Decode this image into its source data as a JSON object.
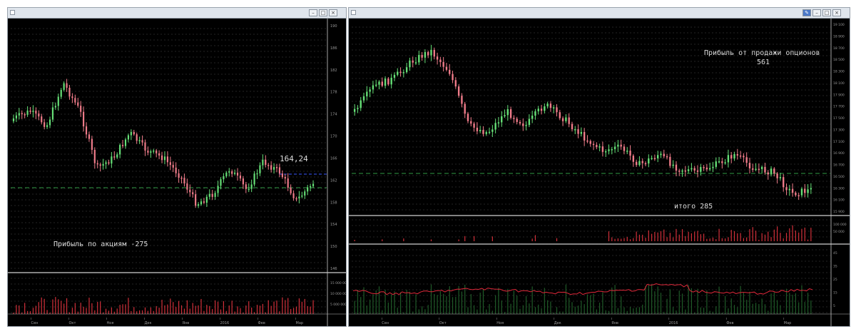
{
  "windows": [
    {
      "id": "left",
      "title": "",
      "annotation_price": "164,24",
      "annotation_profit": "Прибыль по акциям -275",
      "price_axis": [
        "190",
        "186",
        "182",
        "178",
        "174",
        "170",
        "166",
        "162",
        "158",
        "154",
        "150",
        "146"
      ],
      "volume_axis": [
        "15 000 000",
        "10 000 000",
        "5 000 000"
      ],
      "x_labels": [
        "Сен",
        "Окт",
        "Ноя",
        "Дек",
        "Янв",
        "2016",
        "Фев",
        "Мар"
      ]
    },
    {
      "id": "right",
      "title": "",
      "annotation_profit": "Прибыль от продажи опционов",
      "annotation_profit_value": "561",
      "annotation_total": "итого 285",
      "price_axis": [
        "19 100",
        "18 900",
        "18 700",
        "18 500",
        "18 300",
        "18 100",
        "17 900",
        "17 700",
        "17 500",
        "17 300",
        "17 100",
        "16 900",
        "16 700",
        "16 500",
        "16 300",
        "16 100",
        "15 900"
      ],
      "volume_axis": [
        "100 000",
        "50 000"
      ],
      "indicator_axis": [
        "45",
        "35",
        "25",
        "15",
        "5"
      ],
      "x_labels": [
        "Сен",
        "Окт",
        "Ноя",
        "Дек",
        "Янв",
        "2016",
        "Фев",
        "Мар"
      ]
    }
  ],
  "colors": {
    "bull": "#66e077",
    "bear": "#f07c8a",
    "volume": "#d2303a",
    "grid": "#4a4a4a",
    "dashed_green": "#2f9a45",
    "dashed_blue": "#3858ff",
    "indicator_line": "#e0283a",
    "indicator_bars": "#1f5a28",
    "text": "#dcdcdc"
  },
  "icons": [
    "window-icon",
    "minimize-icon",
    "restore-icon",
    "close-icon",
    "pin-icon"
  ]
}
